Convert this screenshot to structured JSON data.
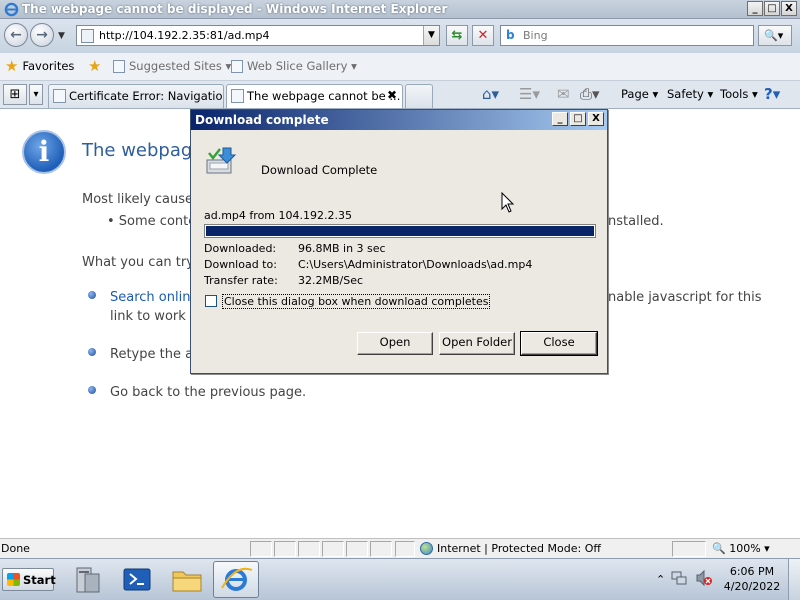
{
  "window": {
    "title": "The webpage cannot be displayed - Windows Internet Explorer",
    "minimize": "_",
    "maximize": "□",
    "close": "X"
  },
  "navbar": {
    "back_glyph": "←",
    "forward_glyph": "→",
    "dropdown_glyph": "▼",
    "url": "http://104.192.2.35:81/ad.mp4",
    "compat_glyph": "⇆",
    "stop_glyph": "✕",
    "search_logo": "b",
    "search_placeholder": "Bing",
    "search_button_glyph": "🔍▾"
  },
  "favorites_bar": {
    "favorites_label": "Favorites",
    "suggested_sites": "Suggested Sites ▾",
    "web_slice_gallery": "Web Slice Gallery ▾"
  },
  "tabs": {
    "quick_tabs_glyph": "⊞",
    "tab_list_glyph": "▾",
    "items": [
      {
        "label": "Certificate Error: Navigation ..."
      },
      {
        "label": "The webpage cannot be ..."
      }
    ],
    "close_glyph": "✖"
  },
  "command_bar": {
    "home_glyph": "⌂▾",
    "feeds_glyph": "☰▾",
    "mail_glyph": "✉",
    "print_glyph": "⎙▾",
    "page_menu": "Page ▾",
    "safety_menu": "Safety ▾",
    "tools_menu": "Tools ▾",
    "help_glyph": "?▾"
  },
  "error_page": {
    "info_glyph": "i",
    "title": "The webpage",
    "most_likely_cause": "Most likely cause:",
    "cause_item": "•  Some conte",
    "cause_item_tail": "nstalled.",
    "what_you_can_try": "What you can try:",
    "search_online": "Search online",
    "search_tail": "nable javascript for this",
    "search_line2": "link to work c",
    "retype": "Retype the ad",
    "go_back": "Go back to the previous page."
  },
  "dialog": {
    "title": "Download complete",
    "heading": "Download Complete",
    "source": "ad.mp4 from 104.192.2.35",
    "progress": 1.0,
    "downloaded_label": "Downloaded:",
    "downloaded_value": "96.8MB in 3 sec",
    "download_to_label": "Download to:",
    "download_to_value": "C:\\Users\\Administrator\\Downloads\\ad.mp4",
    "transfer_rate_label": "Transfer rate:",
    "transfer_rate_value": "32.2MB/Sec",
    "checkbox_label": "Close this dialog box when download completes",
    "checkbox_checked": false,
    "open_button": "Open",
    "open_folder_button": "Open Folder",
    "close_button": "Close"
  },
  "statusbar": {
    "status": "Done",
    "zone": "Internet | Protected Mode: Off",
    "zoom": "🔍 100%  ▾"
  },
  "taskbar": {
    "start_label": "Start",
    "tray_expand": "⌃",
    "time": "6:06 PM",
    "date": "4/20/2022"
  },
  "colors": {
    "dialog_title_start": "#0a246a",
    "dialog_title_end": "#a6caf0",
    "progress_fill": "#0a246a",
    "link": "#1a5cb0"
  }
}
